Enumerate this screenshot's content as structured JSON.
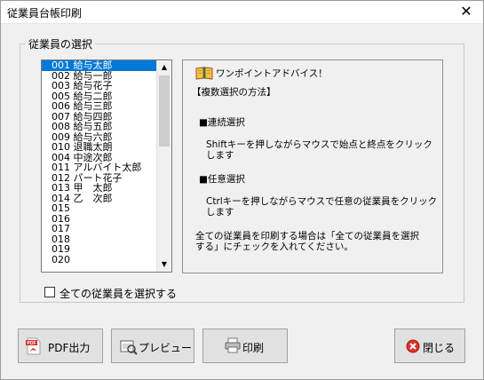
{
  "window": {
    "title": "従業員台帳印刷",
    "close_glyph": "✕"
  },
  "group": {
    "legend": "従業員の選択"
  },
  "employee_list": {
    "items": [
      "001 給与太郎",
      "002 給与一郎",
      "003 給与花子",
      "005 給与二郎",
      "006 給与三郎",
      "007 給与四郎",
      "008 給与五郎",
      "009 給与六郎",
      "010 退職太朗",
      "004 中途次郎",
      "011 アルバイト太郎",
      "012 パート花子",
      "013 甲　太郎",
      "014 乙　次郎",
      "015",
      "016",
      "017",
      "018",
      "019",
      "020"
    ],
    "selected_index": 0,
    "scroll_up_glyph": "▲",
    "scroll_down_glyph": "▼"
  },
  "advice": {
    "icon": "open-book-icon",
    "heading": "ワンポイントアドバイス！",
    "subheading": "【複数選択の方法】",
    "section1_title": "■連続選択",
    "section1_line1": "Shiftキーを押しながらマウスで始点と終点をクリック",
    "section1_line2": "します",
    "section2_title": "■任意選択",
    "section2_line1": "Ctrlキーを押しながらマウスで任意の従業員をクリック",
    "section2_line2": "します",
    "note_line1": "全ての従業員を印刷する場合は「全ての従業員を選択",
    "note_line2": "する」にチェックを入れてください。"
  },
  "select_all": {
    "label": "全ての従業員を選択する",
    "checked": false
  },
  "buttons": {
    "pdf": {
      "label": "PDF出力",
      "icon": "pdf-icon"
    },
    "preview": {
      "label": "プレビュー",
      "icon": "preview-icon"
    },
    "print": {
      "label": "印刷",
      "icon": "printer-icon"
    },
    "close": {
      "label": "閉じる",
      "icon": "close-circle-icon"
    }
  },
  "colors": {
    "selection": "#0078d7",
    "dialog_bg": "#f0f0f0",
    "pdf_red": "#d32f2f",
    "close_red": "#d9342b"
  }
}
